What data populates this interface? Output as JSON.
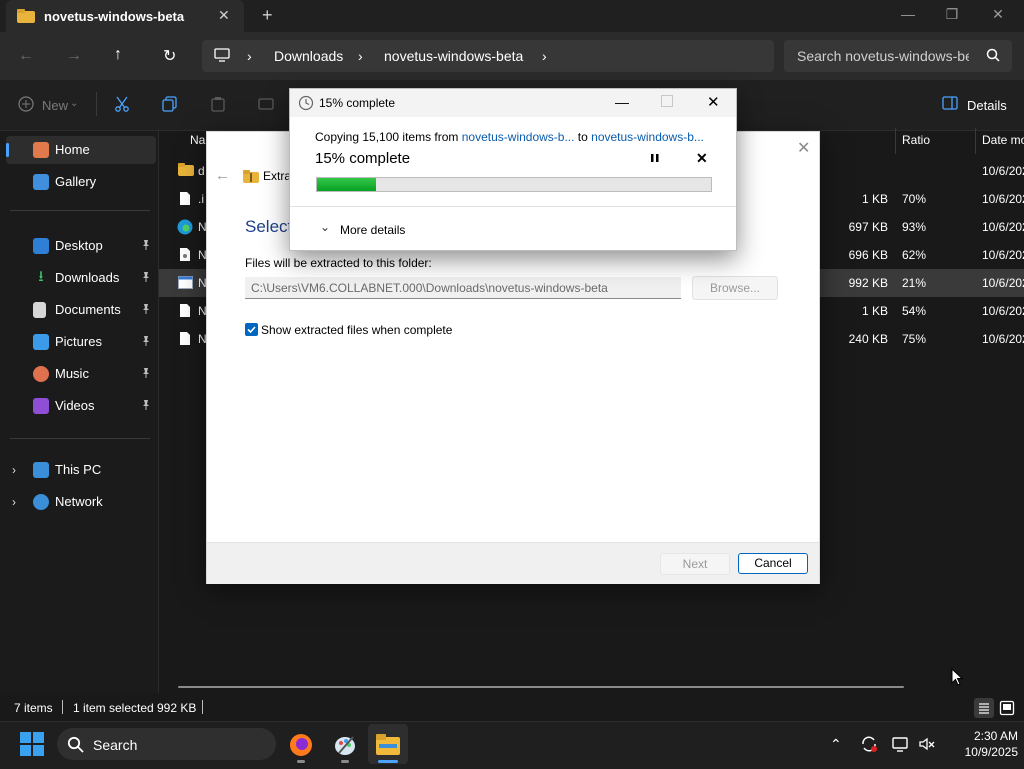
{
  "window": {
    "tab_title": "novetus-windows-beta"
  },
  "address": {
    "crumbs": [
      "Downloads",
      "novetus-windows-beta"
    ],
    "search_placeholder": "Search novetus-windows-beta"
  },
  "toolbar": {
    "new_label": "New",
    "details_label": "Details"
  },
  "sidebar": {
    "items": [
      {
        "label": "Home"
      },
      {
        "label": "Gallery"
      },
      {
        "label": "Desktop"
      },
      {
        "label": "Downloads"
      },
      {
        "label": "Documents"
      },
      {
        "label": "Pictures"
      },
      {
        "label": "Music"
      },
      {
        "label": "Videos"
      },
      {
        "label": "This PC"
      },
      {
        "label": "Network"
      }
    ]
  },
  "file_list": {
    "columns": {
      "name": "Na",
      "ratio": "Ratio",
      "date": "Date mo"
    },
    "rows": [
      {
        "name": "d",
        "size": "",
        "ratio": "",
        "date": "10/6/202"
      },
      {
        "name": ".i",
        "size": "1 KB",
        "ratio": "70%",
        "date": "10/6/202"
      },
      {
        "name": "N",
        "size": "697 KB",
        "ratio": "93%",
        "date": "10/6/202"
      },
      {
        "name": "N",
        "size": "696 KB",
        "ratio": "62%",
        "date": "10/6/202"
      },
      {
        "name": "N",
        "size": "992 KB",
        "ratio": "21%",
        "date": "10/6/202"
      },
      {
        "name": "N",
        "size": "1 KB",
        "ratio": "54%",
        "date": "10/6/202"
      },
      {
        "name": "N",
        "size": "240 KB",
        "ratio": "75%",
        "date": "10/6/202"
      }
    ]
  },
  "wizard": {
    "title": "Extra",
    "heading": "Select",
    "folder_label": "Files will be extracted to this folder:",
    "path_value": "C:\\Users\\VM6.COLLABNET.000\\Downloads\\novetus-windows-beta",
    "browse_label": "Browse...",
    "checkbox_label": "Show extracted files when complete",
    "next_label": "Next",
    "cancel_label": "Cancel"
  },
  "progress": {
    "title": "15% complete",
    "copy_prefix": "Copying 15,100 items from ",
    "source": "novetus-windows-b...",
    "to_text": " to ",
    "dest": "novetus-windows-b...",
    "headline": "15% complete",
    "percent": 15,
    "more_details": "More details"
  },
  "status": {
    "item_count": "7 items",
    "selection": "1 item selected",
    "selection_size": "992 KB"
  },
  "taskbar": {
    "search_label": "Search",
    "time": "2:30 AM",
    "date": "10/9/2025"
  },
  "colors": {
    "accent": "#0067c0",
    "progress_green": "#06b025",
    "link": "#0b5cad"
  }
}
